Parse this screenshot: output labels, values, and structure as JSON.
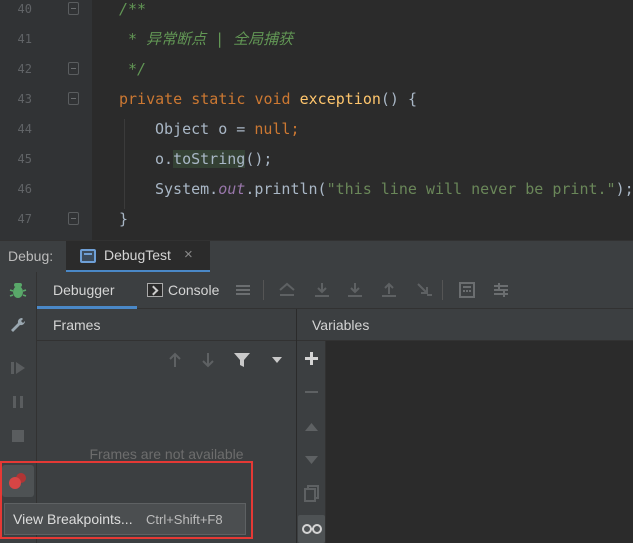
{
  "editor": {
    "lines": [
      {
        "num": "40",
        "code": "/**",
        "kind": "comment"
      },
      {
        "num": "41",
        "code": " * 异常断点 | 全局捕获",
        "kind": "comment"
      },
      {
        "num": "42",
        "code": " */",
        "kind": "comment"
      },
      {
        "num": "43",
        "kind": "method-decl",
        "parts": {
          "kw": "private static void ",
          "name": "exception",
          "rest": "() {"
        }
      },
      {
        "num": "44",
        "kind": "decl",
        "parts": {
          "type": "Object o = ",
          "value": "null",
          "end": ";"
        }
      },
      {
        "num": "45",
        "kind": "call",
        "parts": {
          "obj": "o.",
          "method": "toString",
          "end": "();"
        }
      },
      {
        "num": "46",
        "kind": "print",
        "parts": {
          "cls": "System.",
          "field": "out",
          "call": ".println(",
          "str": "\"this line will never be print.\"",
          "end": ");"
        }
      },
      {
        "num": "47",
        "code": "}",
        "kind": "plain"
      }
    ]
  },
  "debug": {
    "label": "Debug:",
    "session_tab": "DebugTest",
    "close_glyph": "×",
    "tabs": {
      "debugger": "Debugger",
      "console": "Console"
    },
    "frames": {
      "title": "Frames",
      "empty_text": "Frames are not available"
    },
    "variables": {
      "title": "Variables"
    }
  },
  "tooltip": {
    "text": "View Breakpoints...",
    "shortcut": "Ctrl+Shift+F8"
  },
  "colors": {
    "accent": "#4a88c7",
    "highlight": "#e53935",
    "breakpoint": "#d64545"
  }
}
